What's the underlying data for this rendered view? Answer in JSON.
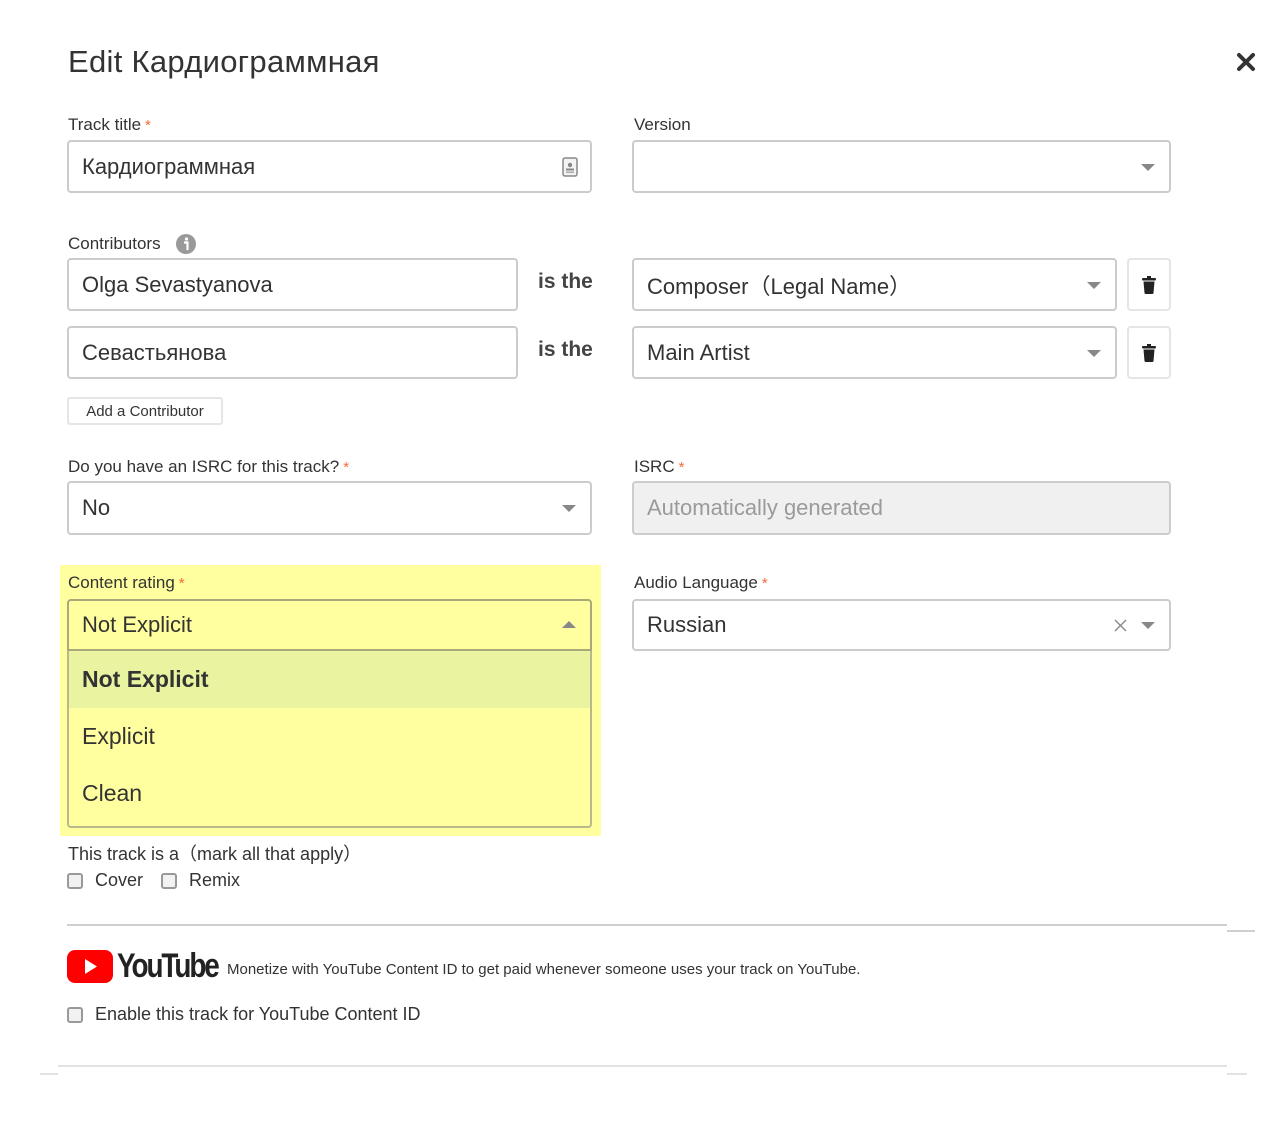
{
  "dialog": {
    "title": "Edit Кардиограммная",
    "close_icon": "close-icon"
  },
  "track_title": {
    "label": "Track title",
    "required_mark": "*",
    "value": "Кардиограммная",
    "icon": "contact-card-icon"
  },
  "version": {
    "label": "Version",
    "value": ""
  },
  "contributors": {
    "label": "Contributors",
    "info_icon": "info-icon",
    "connector": "is the",
    "rows": [
      {
        "name": "Olga Sevastyanova",
        "role": "Composer（Legal Name）"
      },
      {
        "name": "Севастьянова",
        "role": "Main Artist"
      }
    ],
    "add_label": "Add a Contributor"
  },
  "isrc_question": {
    "label": "Do you have an ISRC for this track?",
    "required_mark": "*",
    "value": "No"
  },
  "isrc": {
    "label": "ISRC",
    "required_mark": "*",
    "placeholder": "Automatically generated"
  },
  "content_rating": {
    "label": "Content rating",
    "required_mark": "*",
    "value": "Not Explicit",
    "options": [
      "Not Explicit",
      "Explicit",
      "Clean"
    ],
    "highlight_color": "#ffff9f",
    "selected_option_color": "#eaf4a0"
  },
  "audio_language": {
    "label": "Audio Language",
    "required_mark": "*",
    "value": "Russian"
  },
  "track_type": {
    "label": "This track is a（mark all that apply）",
    "options": [
      {
        "label": "Cover",
        "checked": false
      },
      {
        "label": "Remix",
        "checked": false
      }
    ]
  },
  "youtube": {
    "logo_text": "YouTube",
    "description": "Monetize with YouTube Content ID to get paid whenever someone uses your track on YouTube.",
    "enable_label": "Enable this track for YouTube Content ID",
    "enable_checked": false,
    "brand_color": "#ff0000"
  },
  "colors": {
    "required": "#f26b3a",
    "border": "#cccccc"
  }
}
